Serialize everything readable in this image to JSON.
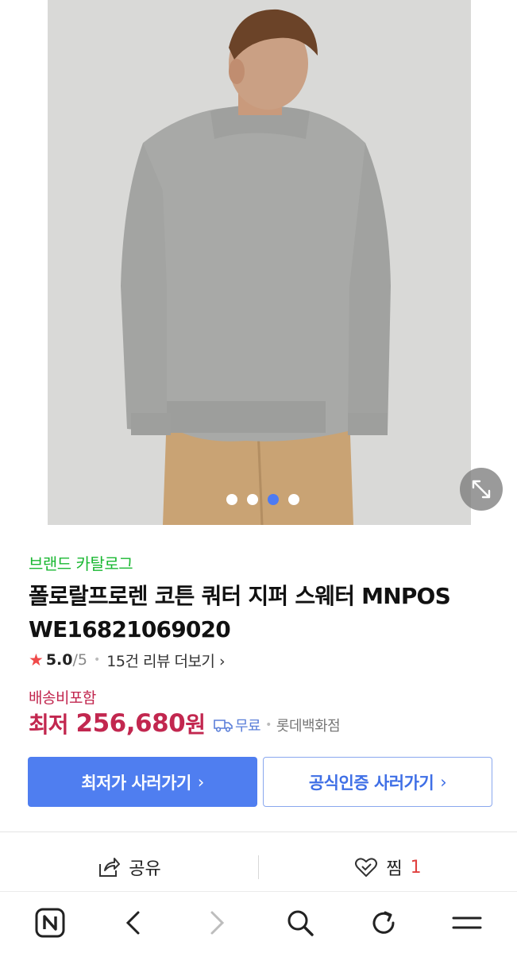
{
  "gallery": {
    "slide_count": 4,
    "active_index": 2,
    "expand_icon": "expand-arrows-icon"
  },
  "product": {
    "brand_link": "브랜드 카탈로그",
    "title_line1": "폴로랄프로렌 코튼 쿼터 지퍼 스웨터 MNPOS",
    "title_line2": "WE16821069020",
    "rating": {
      "score": "5.0",
      "max": "/5",
      "review_link": "15건 리뷰 더보기",
      "review_chevron": "›"
    },
    "shipping_included": "배송비포함",
    "price": {
      "label": "최저",
      "value": "256,680",
      "unit": "원"
    },
    "delivery": {
      "icon": "truck-icon",
      "text": "무료",
      "store": "롯데백화점"
    }
  },
  "buttons": {
    "lowest_price": "최저가 사러가기",
    "official": "공식인증 사러가기",
    "chevron": "›"
  },
  "actions": {
    "share_label": "공유",
    "wish_label": "찜",
    "wish_count": "1"
  },
  "browser_bar": {
    "items": [
      "naver-home-icon",
      "back-icon",
      "forward-icon",
      "search-icon",
      "refresh-icon",
      "menu-icon"
    ]
  },
  "colors": {
    "brand_green": "#1bb833",
    "price_red": "#c2274f",
    "primary_blue": "#4f7ef0",
    "active_dot": "#4d7bf3"
  }
}
